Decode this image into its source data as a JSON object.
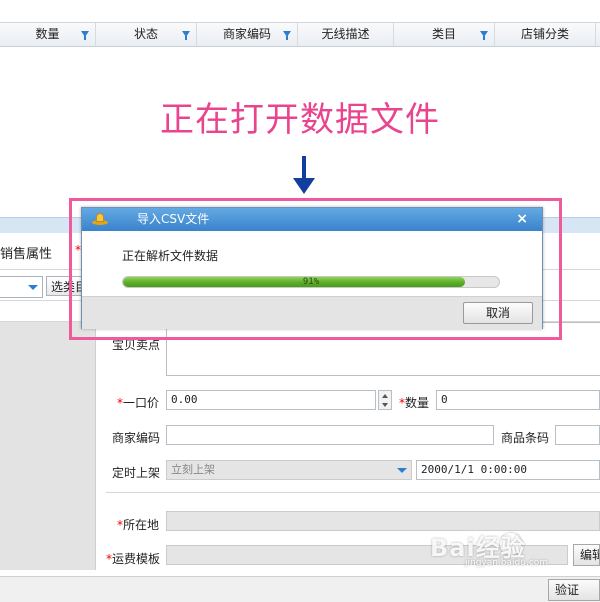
{
  "grid": {
    "columns": [
      {
        "label": "数量",
        "filter": true
      },
      {
        "label": "状态",
        "filter": true
      },
      {
        "label": "商家编码",
        "filter": true
      },
      {
        "label": "无线描述",
        "filter": false
      },
      {
        "label": "类目",
        "filter": true
      },
      {
        "label": "店铺分类",
        "filter": false
      }
    ]
  },
  "annotation": {
    "text": "正在打开数据文件",
    "color": "#e8458e"
  },
  "background_form": {
    "tab_label": "销售属性",
    "tab_star": "*",
    "select_button": "选类目",
    "labels": {
      "selling_points": "宝贝卖点",
      "price": "一口价",
      "quantity": "数量",
      "merchant_code": "商家编码",
      "barcode": "商品条码",
      "scheduled_listing": "定时上架",
      "location": "所在地",
      "shipping_template": "运费模板"
    },
    "required_mark": "*",
    "values": {
      "price": "0.00",
      "quantity": "0",
      "listing_option": "立刻上架",
      "listing_time": "2000/1/1 0:00:00"
    },
    "edit_button": "编辑",
    "bottom_button": "验证"
  },
  "dialog": {
    "title": "导入CSV文件",
    "close_glyph": "×",
    "status": "正在解析文件数据",
    "progress_percent": 91,
    "progress_text": "91%",
    "cancel_label": "取消"
  },
  "watermark": {
    "text": "Bai经验",
    "sub": "jingyan.baidu.com"
  },
  "colors": {
    "accent": "#3983cc",
    "highlight": "#ee5a9a",
    "progress": "#5fb02b",
    "arrow": "#123e9e"
  }
}
